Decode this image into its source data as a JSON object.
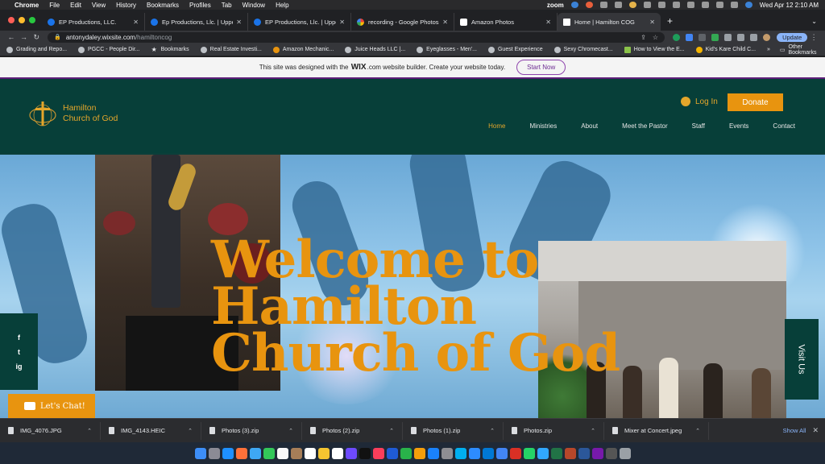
{
  "menubar": {
    "app": "Chrome",
    "items": [
      "File",
      "Edit",
      "View",
      "History",
      "Bookmarks",
      "Profiles",
      "Tab",
      "Window",
      "Help"
    ],
    "zoom_label": "zoom",
    "datetime": "Wed Apr 12  2:10 AM"
  },
  "tabs": [
    {
      "title": "EP Productions, LLC.",
      "favicon_color": "#1a73e8"
    },
    {
      "title": "Ep Productions, Llc. | Upper M",
      "favicon_color": "#1a73e8"
    },
    {
      "title": "EP Productions, Llc. | Upper M",
      "favicon_color": "#1a73e8"
    },
    {
      "title": "recording - Google Photos",
      "favicon_color": "#ea4335"
    },
    {
      "title": "Amazon Photos",
      "favicon_color": "#ffffff"
    },
    {
      "title": "Home | Hamilton COG",
      "favicon_color": "#ffffff"
    }
  ],
  "toolbar": {
    "url_host": "antonydaley.wixsite.com",
    "url_path": "/hamiltoncog",
    "update_label": "Update"
  },
  "bookmarks": [
    "Grading and Repo...",
    "PGCC - People Dir...",
    "Bookmarks",
    "Real Estate Investi...",
    "Amazon Mechanic...",
    "Juice Heads LLC |...",
    "Eyeglasses - Men'...",
    "Guest Experience",
    "Sexy Chromecast...",
    "How to View the E...",
    "Kid's Kare Child C..."
  ],
  "bookmarks_other": "Other Bookmarks",
  "wix_banner": {
    "text_before": "This site was designed with the",
    "brand": "WIX",
    "text_after": ".com website builder. Create your website today.",
    "cta": "Start Now"
  },
  "site": {
    "logo_line1": "Hamilton",
    "logo_line2": "Church of God",
    "login": "Log In",
    "donate": "Donate",
    "nav": [
      "Home",
      "Ministries",
      "About",
      "Meet the Pastor",
      "Staff",
      "Events",
      "Contact"
    ],
    "active_nav": "Home",
    "hero_title_line1": "Welcome to",
    "hero_title_line2": "Hamilton",
    "hero_title_line3": "Church of God",
    "social": [
      "f",
      "t",
      "ig"
    ],
    "visit_label": "Visit Us",
    "chat_label": "Let's Chat!",
    "brand_color": "#073f39",
    "accent_color": "#e8940f"
  },
  "downloads": [
    {
      "name": "IMG_4076.JPG"
    },
    {
      "name": "IMG_4143.HEIC"
    },
    {
      "name": "Photos (3).zip"
    },
    {
      "name": "Photos (2).zip"
    },
    {
      "name": "Photos (1).zip"
    },
    {
      "name": "Photos.zip"
    },
    {
      "name": "Mixer at Concert.jpeg"
    }
  ],
  "downloads_show_all": "Show All"
}
